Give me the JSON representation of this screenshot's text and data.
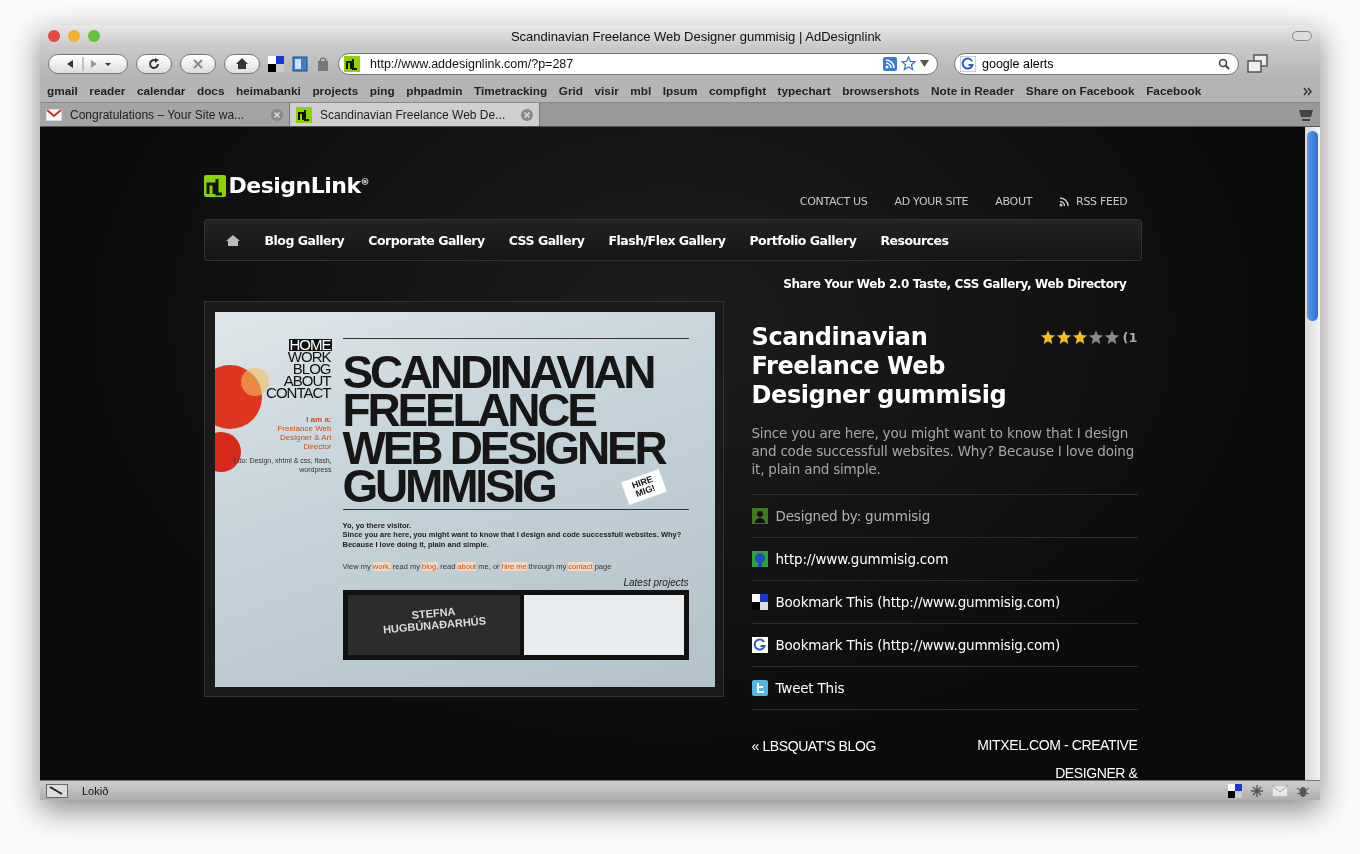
{
  "window": {
    "title": "Scandinavian Freelance Web Designer gummisig | AdDesignlink"
  },
  "toolbar": {
    "url": "http://www.addesignlink.com/?p=287",
    "search": "google alerts"
  },
  "bookmarks": [
    "gmail",
    "reader",
    "calendar",
    "docs",
    "heimabanki",
    "projects",
    "ping",
    "phpadmin",
    "Timetracking",
    "Grid",
    "visir",
    "mbl",
    "Ipsum",
    "compfight",
    "typechart",
    "browsershots",
    "Note in Reader",
    "Share on Facebook",
    "Facebook"
  ],
  "tabs": [
    {
      "label": "Congratulations – Your Site wa...",
      "selected": false,
      "kind": "mail"
    },
    {
      "label": "Scandinavian Freelance Web De...",
      "selected": true,
      "kind": "site"
    }
  ],
  "site": {
    "logo": "DesignLink$^{®}$",
    "top_links": [
      {
        "label": "CONTACT US",
        "kind": "plain"
      },
      {
        "label": "AD YOUR SITE",
        "kind": "plain"
      },
      {
        "label": "ABOUT",
        "kind": "plain"
      },
      {
        "label": "RSS FEED",
        "kind": "rss"
      }
    ],
    "nav": [
      "Blog Gallery",
      "Corporate Gallery",
      "CSS Gallery",
      "Flash/Flex Gallery",
      "Portfolio Gallery",
      "Resources"
    ],
    "tagline": "Share Your Web 2.0 Taste, CSS Gallery, Web Directory"
  },
  "preview": {
    "menu": [
      {
        "label": "HOME",
        "selected": true
      },
      {
        "label": "WORK",
        "selected": false
      },
      {
        "label": "BLOG",
        "selected": false
      },
      {
        "label": "ABOUT",
        "selected": false
      },
      {
        "label": "CONTACT",
        "selected": false
      }
    ],
    "role_heading": "I am a:",
    "role": "Freelance Web Designer & Art Director",
    "skills": "I do: Design, xhtml & css, flash, wordpress",
    "headline": [
      "SCANDINAVIAN",
      "FREELANCE",
      "WEB DESIGNER",
      "GUMMISIG"
    ],
    "sign": "HIRE MIG!",
    "greeting": "Yo, yo there visitor.",
    "intro": "Since you are here, you might want to know that I design and code successfull websites. Why? Because I love doing it, plain and simple.",
    "links_line": [
      {
        "text": "View my ",
        "link": false
      },
      {
        "text": "work,",
        "link": true
      },
      {
        "text": " read my ",
        "link": false
      },
      {
        "text": "blog,",
        "link": true
      },
      {
        "text": " read ",
        "link": false
      },
      {
        "text": "about",
        "link": true
      },
      {
        "text": " me, or ",
        "link": false
      },
      {
        "text": "hire me",
        "link": true
      },
      {
        "text": " through my ",
        "link": false
      },
      {
        "text": "contact",
        "link": true
      },
      {
        "text": " page",
        "link": false
      }
    ],
    "latest": "Latest projects",
    "project_title": "STEFNA HUGBÚNAÐARHÚS"
  },
  "detail": {
    "title": "Scandinavian Freelance Web Designer gummisig",
    "stars": 3,
    "rating_count": "(1",
    "description": "Since you are here, you might want to know that I design and code successfull websites. Why? Because I love doing it, plain and simple.",
    "links": [
      {
        "kind": "designer",
        "text": "Designed by: gummisig"
      },
      {
        "kind": "website",
        "text": "http://www.gummisig.com"
      },
      {
        "kind": "delicious",
        "text": "Bookmark This (http://www.gummisig.com)"
      },
      {
        "kind": "google",
        "text": "Bookmark This (http://www.gummisig.com)"
      },
      {
        "kind": "twitter",
        "text": "Tweet This"
      }
    ]
  },
  "post_nav": {
    "previous": "« LBSQUAT'S BLOG",
    "next": "MITXEL.COM - CREATIVE DESIGNER &"
  },
  "status_bar": {
    "text": "Lokið"
  }
}
